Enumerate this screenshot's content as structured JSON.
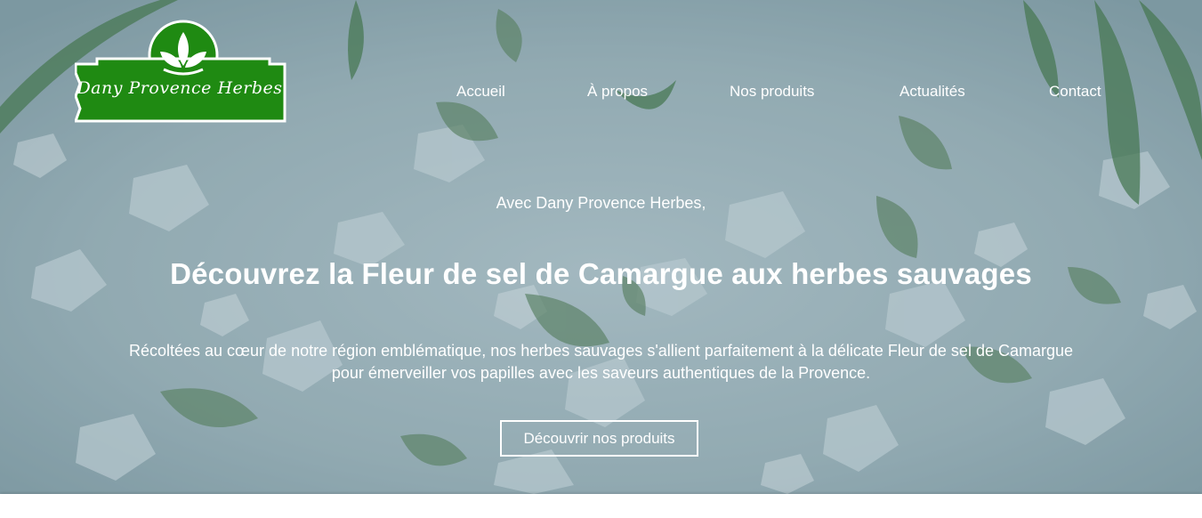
{
  "brand": {
    "logo_text": "Dany Provence Herbes",
    "logo_color": "#1f8a12",
    "logo_icon": "leaf-sprout-icon"
  },
  "nav": {
    "items": [
      {
        "label": "Accueil"
      },
      {
        "label": "À propos"
      },
      {
        "label": "Nos produits"
      },
      {
        "label": "Actualités"
      },
      {
        "label": "Contact"
      }
    ]
  },
  "hero": {
    "tagline": "Avec Dany Provence Herbes,",
    "headline": "Découvrez la Fleur de sel de Camargue aux herbes sauvages",
    "description": "Récoltées au cœur de notre région emblématique, nos herbes sauvages s'allient parfaitement à la délicate Fleur de sel de Camargue pour émerveiller vos papilles avec les saveurs authentiques de la Provence.",
    "cta_label": "Découvrir nos produits",
    "background": "sea-salt-crystals-with-dried-herbs"
  }
}
